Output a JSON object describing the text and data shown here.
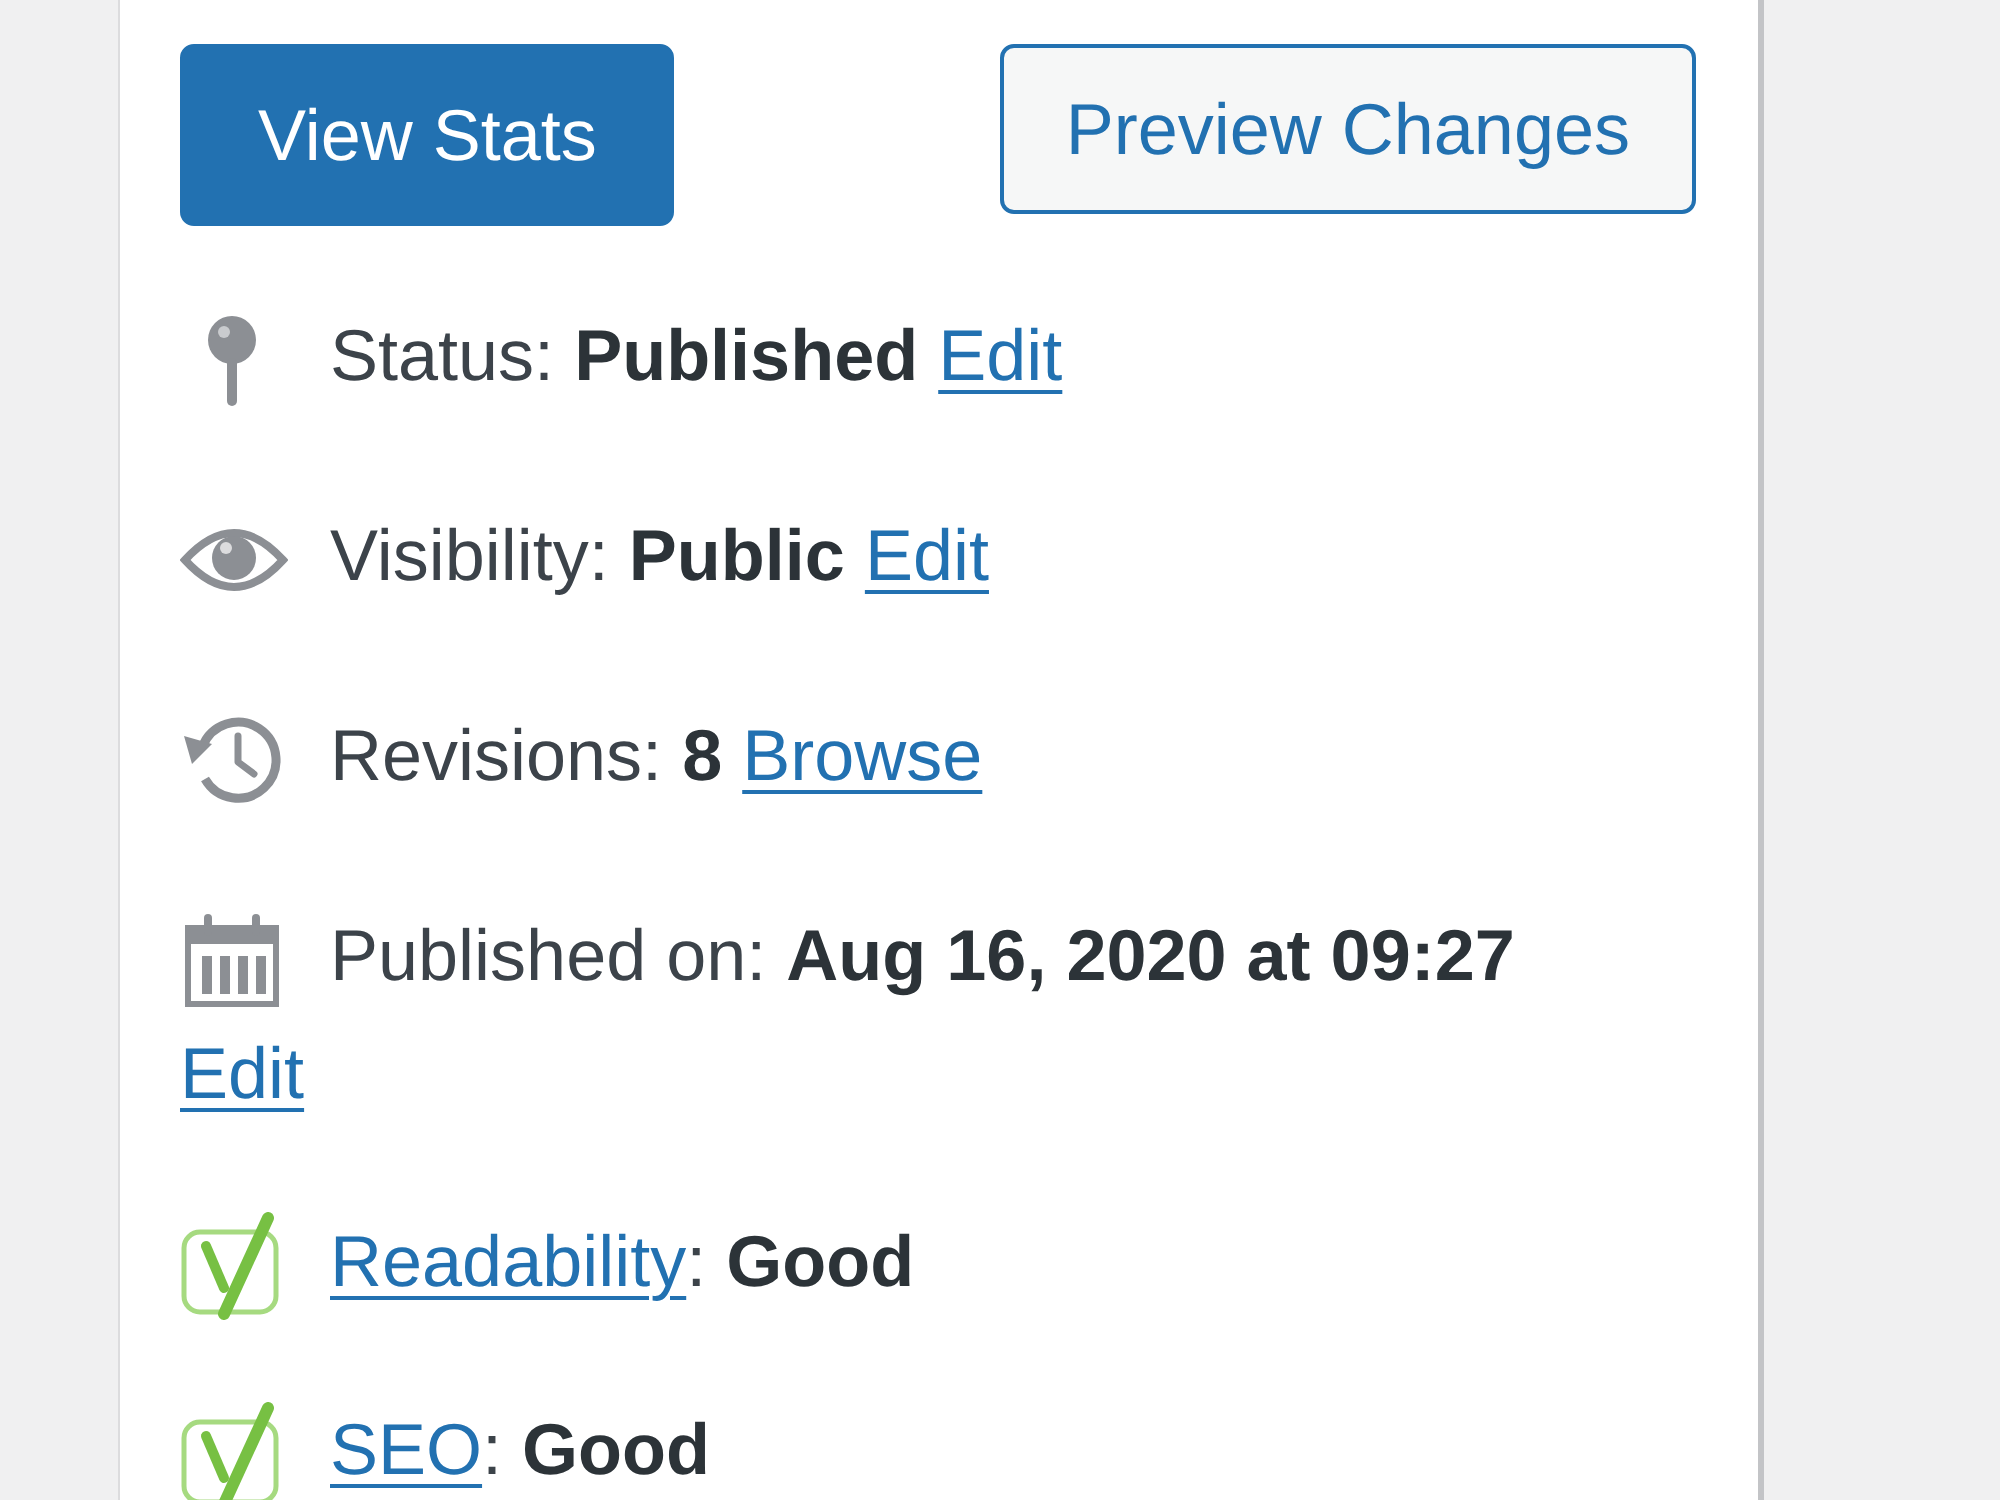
{
  "buttons": [
    {
      "label": "View Stats",
      "kind": "primary"
    },
    {
      "label": "Preview Changes",
      "kind": "secondary"
    }
  ],
  "rows": [
    {
      "kind": "status",
      "text": "Status: **Published**",
      "link": "Edit"
    },
    {
      "kind": "visibility",
      "text": "Visibility: **Public**",
      "link": "Edit"
    },
    {
      "kind": "revisions",
      "text": "Revisions: **8**",
      "link": "Browse"
    },
    {
      "kind": "published",
      "text": "Published on: **Aug 16, 2020 at 09:27**",
      "link": "Edit"
    },
    {
      "kind": "readability",
      "link": "Readability",
      "text": ": **Good**"
    },
    {
      "kind": "seo",
      "link": "SEO",
      "text": ": **Good**"
    }
  ]
}
